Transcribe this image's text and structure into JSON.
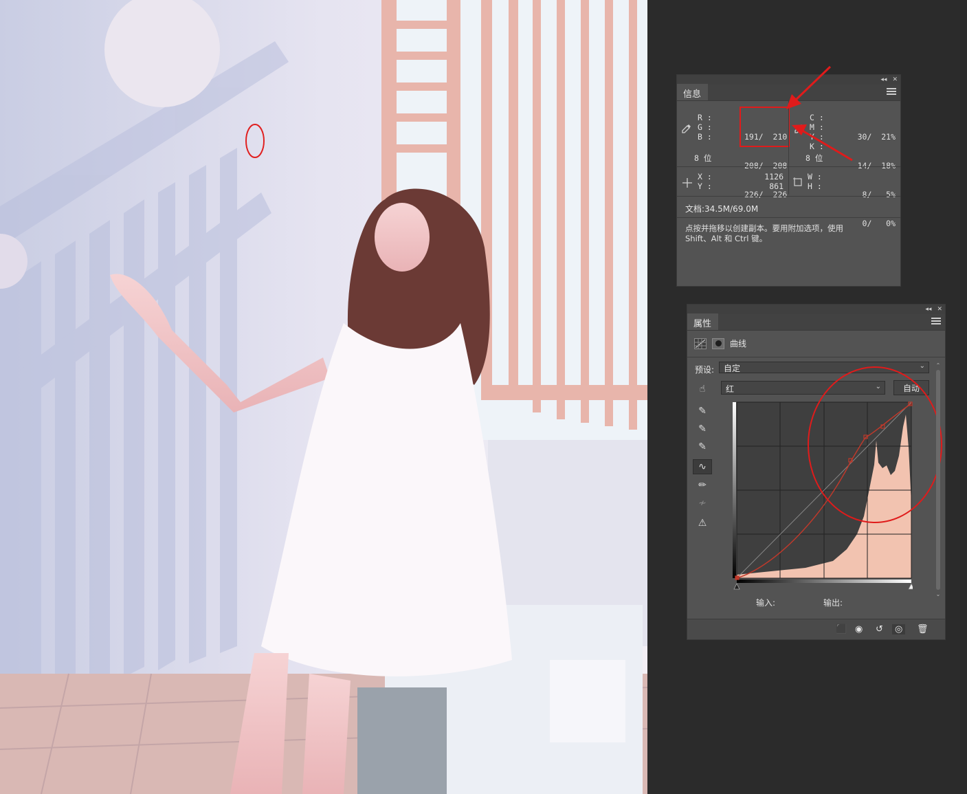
{
  "info_panel": {
    "tab_label": "信息",
    "rgb": {
      "r_label": "R :",
      "g_label": "G :",
      "b_label": "B :",
      "r_value": "191/  210",
      "g_value": "208/  208",
      "b_value": "226/  226"
    },
    "bits_left": "8 位",
    "cmyk": {
      "c_label": "C :",
      "m_label": "M :",
      "y_label": "Y :",
      "k_label": "K :",
      "c_value": "30/  21%",
      "m_value": "14/  18%",
      "y_value": "8/   5%",
      "k_value": "0/   0%"
    },
    "bits_right": "8 位",
    "xy": {
      "x_label": "X :",
      "y_label": "Y :",
      "x_value": "1126",
      "y_value": "861"
    },
    "wh": {
      "w_label": "W :",
      "h_label": "H :"
    },
    "doc_size": "文档:34.5M/69.0M",
    "hint_line1": "点按并拖移以创建副本。要用附加选项，使用",
    "hint_line2": "Shift、Alt 和 Ctrl 键。"
  },
  "properties_panel": {
    "tab_label": "属性",
    "adjustment_name": "曲线",
    "preset_label": "预设:",
    "preset_value": "自定",
    "channel_value": "红",
    "auto_button": "自动",
    "input_label": "输入:",
    "output_label": "输出:",
    "accent_color": "#c0392b",
    "histogram_fill": "#f2c3b0"
  },
  "icons": [
    "eyedropper-icon",
    "crosshair-icon",
    "marquee-icon",
    "curves-icon",
    "mask-icon",
    "hand-icon",
    "pencil-icon",
    "smooth-icon",
    "clip-warning-icon",
    "clip-to-layer-icon",
    "view-previous-icon",
    "reset-icon",
    "visibility-icon",
    "trash-icon"
  ]
}
